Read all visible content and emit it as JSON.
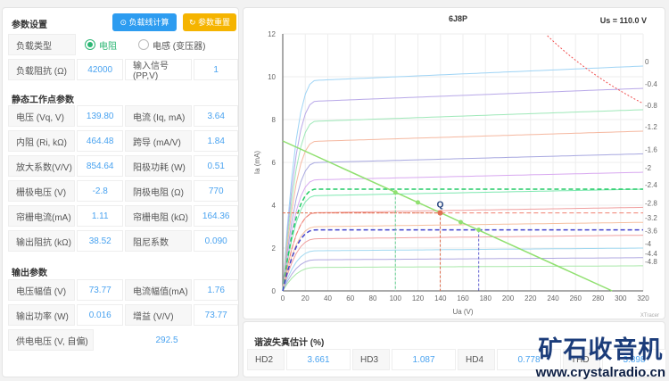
{
  "settings": {
    "title": "参数设置",
    "btn_calc": "负载线计算",
    "btn_reset": "参数重置",
    "load_type_label": "负载类型",
    "opt_resistor": "电阻",
    "opt_inductor": "电感 (变压器)",
    "load_imp_label": "负载阻抗 (Ω)",
    "load_imp": "42000",
    "input_label": "输入信号(PP,V)",
    "input": "1"
  },
  "static": {
    "title": "静态工作点参数",
    "rows": [
      [
        "电压 (Vq, V)",
        "139.80",
        "电流 (Iq, mA)",
        "3.64"
      ],
      [
        "内阻 (Ri, kΩ)",
        "464.48",
        "跨导 (mA/V)",
        "1.84"
      ],
      [
        "放大系数(V/V)",
        "854.64",
        "阳极功耗 (W)",
        "0.51"
      ],
      [
        "栅极电压 (V)",
        "-2.8",
        "阴极电阻 (Ω)",
        "770"
      ],
      [
        "帘栅电流(mA)",
        "1.11",
        "帘栅电阻 (kΩ)",
        "164.36"
      ],
      [
        "输出阻抗 (kΩ)",
        "38.52",
        "阻尼系数",
        "0.090"
      ]
    ]
  },
  "output": {
    "title": "输出参数",
    "rows": [
      [
        "电压幅值 (V)",
        "73.77",
        "电流幅值(mA)",
        "1.76"
      ],
      [
        "输出功率 (W)",
        "0.016",
        "增益 (V/V)",
        "73.77"
      ]
    ],
    "supply_label": "供电电压 (V, 自偏)",
    "supply": "292.5"
  },
  "harmonics": {
    "title": "谐波失真估计 (%)",
    "items": [
      [
        "HD2",
        "3.661"
      ],
      [
        "HD3",
        "1.087"
      ],
      [
        "HD4",
        "0.778"
      ],
      [
        "THD",
        "3.898"
      ]
    ]
  },
  "watermark": {
    "line1": "矿石收音机",
    "line2": "www.crystalradio.cn"
  },
  "chart_data": {
    "type": "line",
    "title": "6J8P",
    "us_label": "Us = 110.0 V",
    "xlabel": "Ua (V)",
    "ylabel": "Ia (mA)",
    "xlim": [
      0,
      320
    ],
    "ylim": [
      0,
      12
    ],
    "xticks": [
      0,
      20,
      40,
      60,
      80,
      100,
      120,
      140,
      160,
      180,
      200,
      220,
      240,
      260,
      280,
      300,
      320
    ],
    "yticks": [
      0,
      2,
      4,
      6,
      8,
      10,
      12
    ],
    "curves": [
      {
        "vg": "0",
        "ia": 10.5
      },
      {
        "vg": "-0.4",
        "ia": 9.46
      },
      {
        "vg": "-0.8",
        "ia": 8.46
      },
      {
        "vg": "-1.2",
        "ia": 7.46
      },
      {
        "vg": "-1.6",
        "ia": 6.4
      },
      {
        "vg": "-2",
        "ia": 5.54
      },
      {
        "vg": "-2.4",
        "ia": 4.75
      },
      {
        "vg": "-2.8",
        "ia": 3.9
      },
      {
        "vg": "-3.2",
        "ia": 3.2
      },
      {
        "vg": "-3.6",
        "ia": 2.6
      },
      {
        "vg": "-4",
        "ia": 2.0
      },
      {
        "vg": "-4.4",
        "ia": 1.55
      },
      {
        "vg": "-4.8",
        "ia": 1.17
      }
    ],
    "load_line": [
      [
        0,
        7.0
      ],
      [
        292.5,
        0
      ]
    ],
    "q_point": {
      "label": "Q",
      "ua": 139.8,
      "ia": 3.64
    },
    "swing": [
      [
        100,
        4.6
      ],
      [
        174,
        2.85
      ]
    ],
    "max_power_w": 2.8,
    "brand": "XTracer",
    "colors": {
      "load": "#90e070",
      "q": "#e07050",
      "power": "#f05050"
    }
  }
}
